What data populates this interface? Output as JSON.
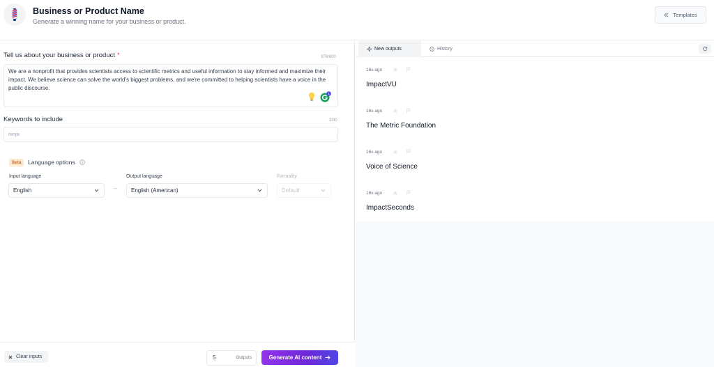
{
  "header": {
    "title": "Business or Product Name",
    "subtitle": "Generate a winning name for your business or product.",
    "templates_label": "Templates"
  },
  "form": {
    "about": {
      "label": "Tell us about your business or product",
      "required_mark": "*",
      "counter": "378/600",
      "value": "We are a nonprofit that provides scientists access to scientific metrics and useful information to stay informed and maximize their impact. We believe science can solve the world's biggest problems, and we're committed to helping scientists have a voice in the public discourse."
    },
    "keywords": {
      "label": "Keywords to include",
      "counter": "3/80",
      "placeholder": "ninja"
    },
    "language": {
      "beta": "Beta",
      "title": "Language options",
      "input_label": "Input language",
      "input_value": "English",
      "output_label": "Output language",
      "output_value": "English (American)",
      "formality_label": "Formality",
      "formality_value": "Default",
      "arrow": "→"
    }
  },
  "bottom": {
    "clear_label": "Clear inputs",
    "outputs_count": "5",
    "outputs_label": "Outputs",
    "generate_label": "Generate AI content"
  },
  "results": {
    "tabs": [
      {
        "label": "New outputs",
        "active": true
      },
      {
        "label": "History",
        "active": false
      }
    ],
    "items": [
      {
        "time": "16s ago",
        "text": "ImpactVU"
      },
      {
        "time": "16s ago",
        "text": "The Metric Foundation"
      },
      {
        "time": "16s ago",
        "text": "Voice of Science"
      },
      {
        "time": "16s ago",
        "text": "ImpactSeconds"
      }
    ]
  },
  "colors": {
    "accent_start": "#9333ea",
    "accent_end": "#4f46e5",
    "required": "#ef4444",
    "beta_bg": "#fde8cc"
  },
  "icons": [
    "barber-pole-logo-icon",
    "chevrons-left-icon",
    "lightbulb-icon",
    "grammarly-icon",
    "info-icon",
    "chevron-down-icon",
    "close-icon",
    "arrow-right-icon",
    "sparkle-icon",
    "clock-icon",
    "refresh-icon",
    "star-icon",
    "flag-icon"
  ]
}
